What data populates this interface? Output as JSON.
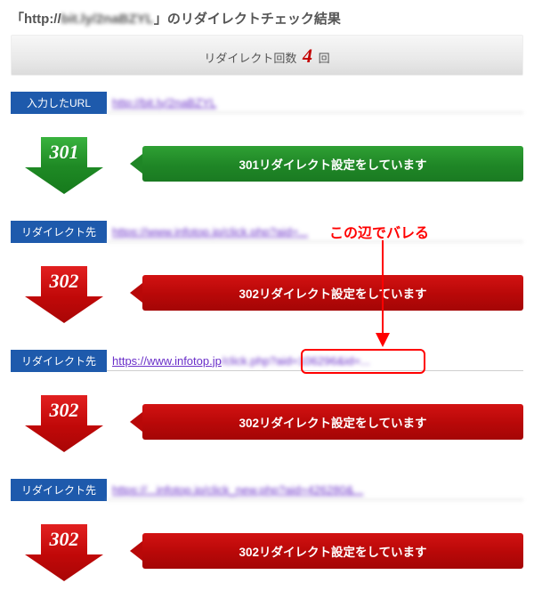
{
  "title_prefix": "「http://",
  "title_url_hidden": "bit.ly/2naBZYL",
  "title_suffix": "」のリダイレクトチェック結果",
  "count_label_prefix": "リダイレクト回数 ",
  "count_value": "4",
  "count_label_suffix": " 回",
  "labels": {
    "input_url": "入力したURL",
    "redirect_to": "リダイレクト先"
  },
  "rows": [
    {
      "label_key": "input_url",
      "url_display": "http://bit.ly/2naBZYL",
      "blur_full": true
    },
    {
      "label_key": "redirect_to",
      "url_display": "https://www.infotop.jp/click.php?aid=...",
      "blur_full": true
    },
    {
      "label_key": "redirect_to",
      "url_display": "https://www.infotop.jp/...&id=106296&d=...",
      "blur_full": false
    },
    {
      "label_key": "redirect_to",
      "url_display": "https://...infotop.jp/click_new.php?aid=426280&...",
      "blur_full": true
    }
  ],
  "redirects": [
    {
      "code": "301",
      "color": "green",
      "message": "301リダイレクト設定をしています"
    },
    {
      "code": "302",
      "color": "red",
      "message": "302リダイレクト設定をしています"
    },
    {
      "code": "302",
      "color": "red",
      "message": "302リダイレクト設定をしています"
    },
    {
      "code": "302",
      "color": "red",
      "message": "302リダイレクト設定をしています"
    }
  ],
  "annotation": {
    "text": "この辺でバレる"
  }
}
